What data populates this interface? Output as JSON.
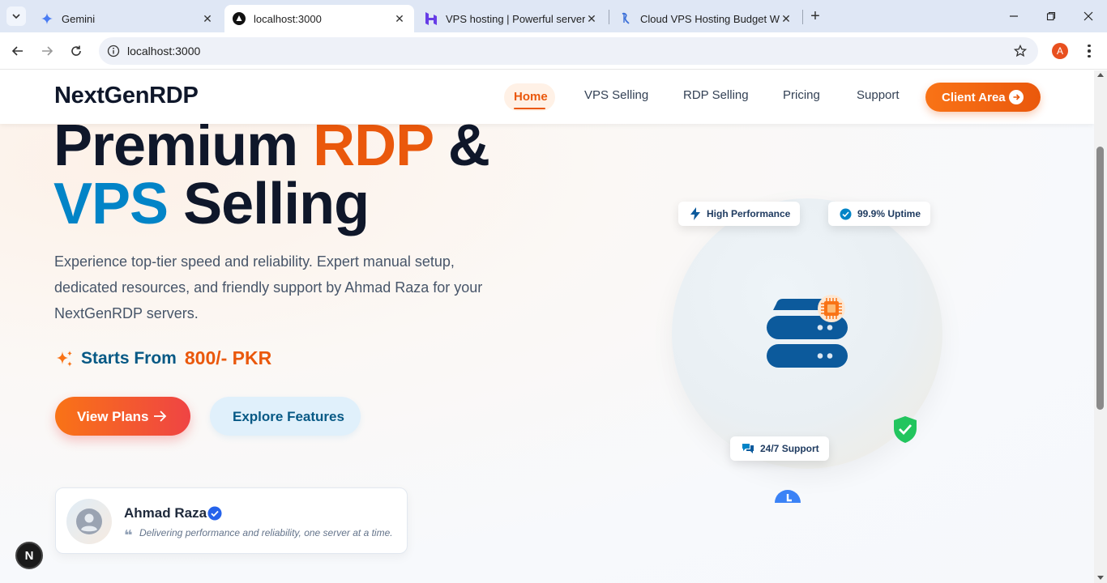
{
  "browser": {
    "tabs": [
      {
        "title": "Gemini",
        "icon": "gemini-icon",
        "active": false
      },
      {
        "title": "localhost:3000",
        "icon": "nextjs-icon",
        "active": true
      },
      {
        "title": "VPS hosting | Powerful server an",
        "icon": "hostinger-icon",
        "active": false
      },
      {
        "title": "Cloud VPS Hosting Budget Wind",
        "icon": "host-logo-icon",
        "active": false
      }
    ],
    "url": "localhost:3000",
    "profile_initial": "A"
  },
  "nav": {
    "brand": "NextGenRDP",
    "links": [
      "Home",
      "VPS Selling",
      "RDP Selling",
      "Pricing",
      "Support"
    ],
    "active_link": "Home",
    "cta": "Client Area"
  },
  "hero": {
    "line1_part1": "Premium ",
    "line1_accent": "RDP",
    "line1_part2": " &",
    "line2_accent": "VPS",
    "line2_part2": " Selling",
    "description": "Experience top-tier speed and reliability. Expert manual setup, dedicated resources, and friendly support by Ahmad Raza for your NextGenRDP servers.",
    "starts_label": "Starts From",
    "price": "800/- PKR",
    "primary_button": "View Plans",
    "secondary_button": "Explore Features"
  },
  "author": {
    "name": "Ahmad Raza",
    "quote": "Delivering performance and reliability, one server at a time."
  },
  "illustration": {
    "badges": {
      "performance": "High Performance",
      "uptime": "99.9% Uptime",
      "support": "24/7 Support"
    }
  },
  "colors": {
    "accent_orange": "#ea580c",
    "accent_blue": "#0284c7",
    "dark_text": "#0f172a"
  },
  "dev_badge": "N"
}
